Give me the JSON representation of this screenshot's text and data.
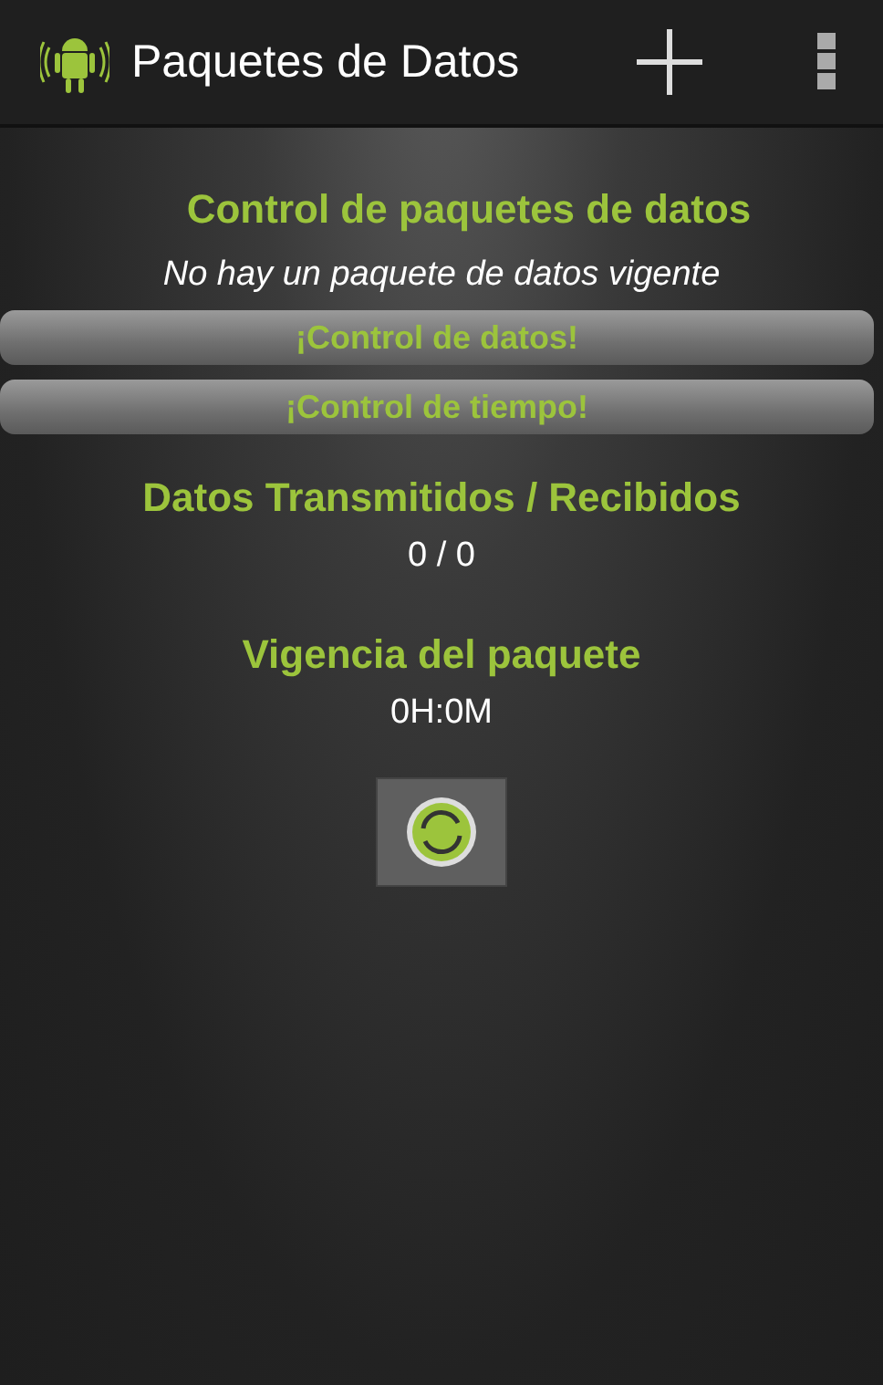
{
  "action_bar": {
    "title": "Paquetes de Datos"
  },
  "header": "Control de paquetes de datos",
  "status": "No hay un paquete de datos vigente",
  "buttons": [
    "¡Control de datos!",
    "¡Control de tiempo!"
  ],
  "sections": [
    {
      "title": "Datos Transmitidos / Recibidos",
      "value": "0 / 0"
    },
    {
      "title": "Vigencia del paquete",
      "value": "0H:0M"
    }
  ]
}
